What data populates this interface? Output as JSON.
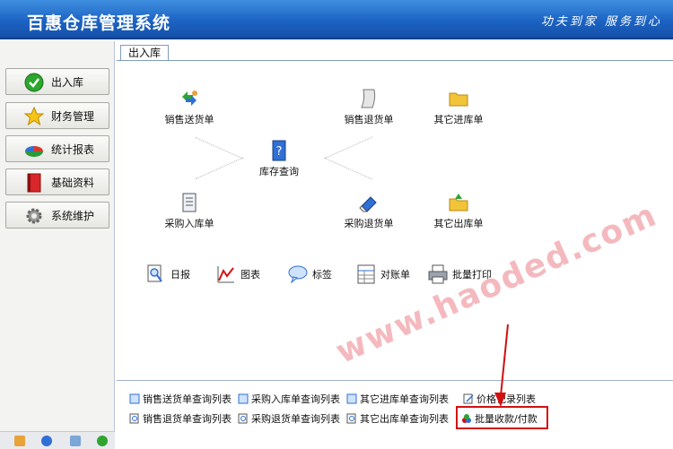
{
  "window": {
    "app_title": "百惠仓库管理系统",
    "slogan": "功夫到家 服务到心"
  },
  "sidebar": {
    "items": [
      {
        "label": "出入库",
        "icon": "check-circle-icon"
      },
      {
        "label": "财务管理",
        "icon": "star-icon"
      },
      {
        "label": "统计报表",
        "icon": "pie-chart-icon"
      },
      {
        "label": "基础资料",
        "icon": "book-icon"
      },
      {
        "label": "系统维护",
        "icon": "gear-icon"
      }
    ],
    "bottom_icons": [
      "edit-icon",
      "help-icon",
      "window-icon",
      "exit-icon"
    ]
  },
  "tabs": [
    {
      "label": "出入库"
    }
  ],
  "flow": {
    "nodes": [
      {
        "label": "销售送货单",
        "icon": "recycle-arrows-icon"
      },
      {
        "label": "销售退货单",
        "icon": "scroll-icon"
      },
      {
        "label": "其它进库单",
        "icon": "folder-icon"
      },
      {
        "label": "库存查询",
        "icon": "question-book-icon"
      },
      {
        "label": "采购入库单",
        "icon": "document-icon"
      },
      {
        "label": "采购退货单",
        "icon": "eraser-icon"
      },
      {
        "label": "其它出库单",
        "icon": "folder-out-icon"
      }
    ]
  },
  "tools": [
    {
      "label": "日报",
      "icon": "magnifier-report-icon"
    },
    {
      "label": "图表",
      "icon": "line-chart-icon"
    },
    {
      "label": "标签",
      "icon": "speech-bubble-icon"
    },
    {
      "label": "对账单",
      "icon": "spreadsheet-icon"
    },
    {
      "label": "批量打印",
      "icon": "printer-icon"
    }
  ],
  "watermark": "www.haoded.com",
  "quick_links": {
    "row1": [
      "销售送货单查询列表",
      "采购入库单查询列表",
      "其它进库单查询列表",
      "价格记录列表"
    ],
    "row2": [
      "销售退货单查询列表",
      "采购退货单查询列表",
      "其它出库单查询列表",
      "批量收款/付款"
    ]
  },
  "colors": {
    "titlebar": "#1c64c4",
    "highlight": "#d21010",
    "accent_arrow": "#d21010"
  }
}
